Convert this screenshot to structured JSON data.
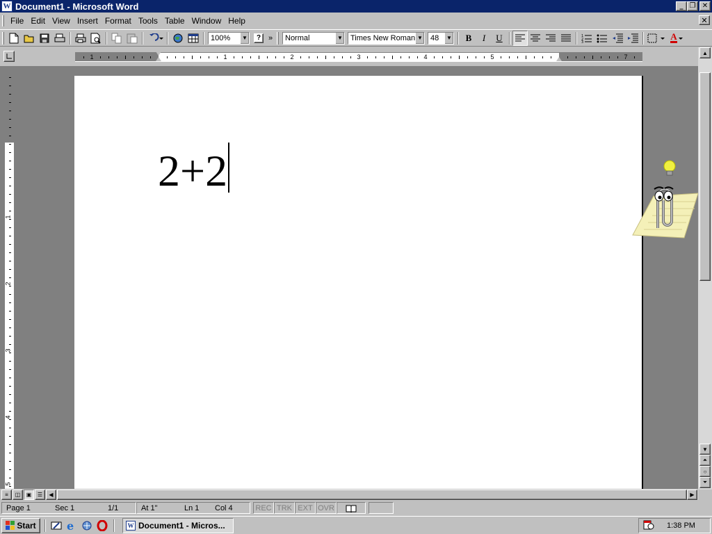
{
  "window": {
    "title": "Document1 - Microsoft Word",
    "icon": "word-document-icon",
    "controls": [
      "minimize-icon",
      "restore-icon",
      "close-icon"
    ]
  },
  "menu": {
    "items": [
      {
        "label": "File"
      },
      {
        "label": "Edit"
      },
      {
        "label": "View"
      },
      {
        "label": "Insert"
      },
      {
        "label": "Format"
      },
      {
        "label": "Tools"
      },
      {
        "label": "Table"
      },
      {
        "label": "Window"
      },
      {
        "label": "Help"
      }
    ]
  },
  "toolbar": {
    "zoom": "100%",
    "style": "Normal",
    "font": "Times New Roman",
    "size": "48",
    "bold": "B",
    "italic": "I",
    "underline": "U",
    "help": "?",
    "more": "»",
    "font_color_letter": "A",
    "font_color": "#d00000",
    "icons": [
      "new-icon",
      "open-icon",
      "save-icon",
      "print-preview-icon",
      "print-icon",
      "preview-icon",
      "copy-icon",
      "paste-icon",
      "undo-icon",
      "web-icon",
      "table-icon",
      "align-left-icon",
      "align-center-icon",
      "align-right-icon",
      "justify-icon",
      "numbering-icon",
      "bullets-icon",
      "decrease-indent-icon",
      "increase-indent-icon",
      "border-icon"
    ]
  },
  "ruler": {
    "horizontal_numbers": [
      "1",
      "1",
      "2",
      "3",
      "4",
      "5",
      "7"
    ],
    "vertical_numbers": [
      "1",
      "2",
      "3",
      "4",
      "5"
    ]
  },
  "document": {
    "text": "2+2"
  },
  "status": {
    "page": "Page  1",
    "sec": "Sec  1",
    "pages": "1/1",
    "at": "At  1\"",
    "ln": "Ln  1",
    "col": "Col  4",
    "rec": "REC",
    "trk": "TRK",
    "ext": "EXT",
    "ovr": "OVR"
  },
  "taskbar": {
    "start": "Start",
    "task": "Document1 - Micros...",
    "clock": "1:38 PM"
  },
  "colors": {
    "titlebar": "#0a246a",
    "face": "#c0c0c0",
    "workspace": "#808080"
  }
}
